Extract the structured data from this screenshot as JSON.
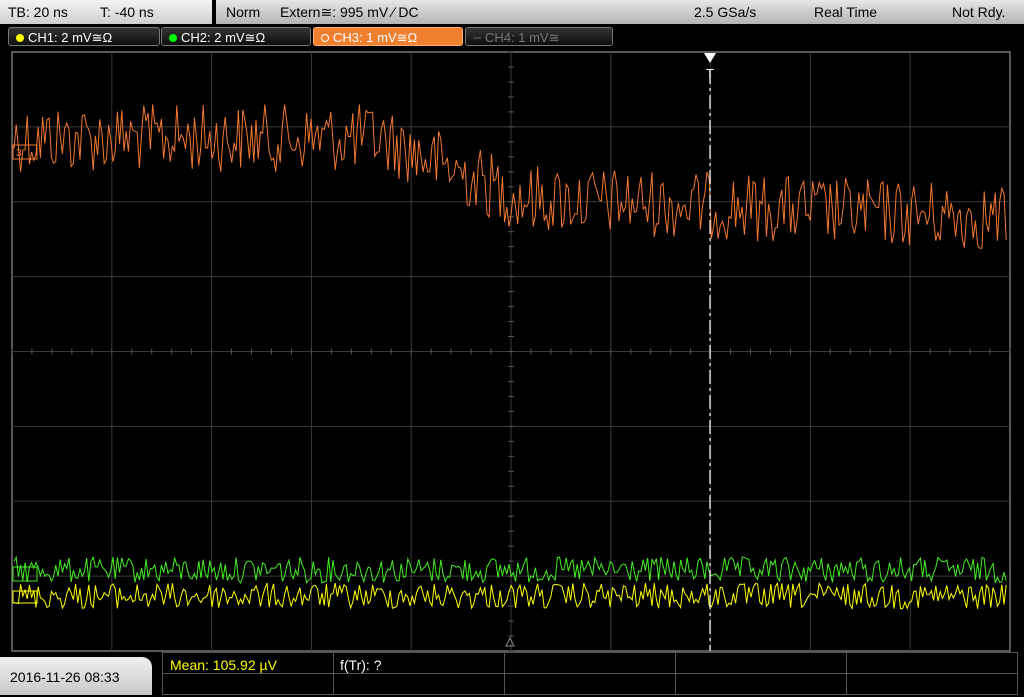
{
  "timebase": {
    "tb_label": "TB: 20 ns",
    "trigger_time": "T: -40 ns"
  },
  "status": {
    "trigger_mode": "Norm",
    "trigger_source": "Extern≅: 995 mV ⁄ DC",
    "sample_rate": "2.5 GSa/s",
    "acq_mode": "Real Time",
    "ready_state": "Not Rdy."
  },
  "channels": [
    {
      "label": "CH1: 2 mV≅Ω",
      "color": "#ffff00",
      "state": "on"
    },
    {
      "label": "CH2: 2 mV≅Ω",
      "color": "#00ff00",
      "state": "on"
    },
    {
      "label": "CH3: 1 mV≅Ω",
      "color": "#f08030",
      "state": "active"
    },
    {
      "label": "CH4: 1 mV≅",
      "color": "#666666",
      "state": "off"
    }
  ],
  "colors": {
    "ch1": "#ffff00",
    "ch2": "#44ee22",
    "ch3": "#f07830",
    "grid": "#3a3a3a"
  },
  "markers": {
    "trigger_marker": "T",
    "ch_ref_label": "3"
  },
  "measurements": {
    "mean": "Mean: 105.92 µV",
    "freq": "f(Tr): ?"
  },
  "datetime": "2016-11-26 08:33"
}
